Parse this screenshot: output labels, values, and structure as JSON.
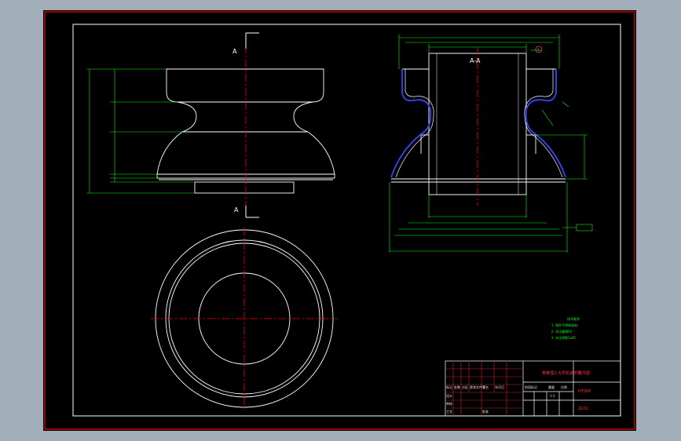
{
  "drawing": {
    "section_mark_top": "A",
    "section_mark_bottom": "A",
    "section_title": "A-A",
    "balloon_label": "1"
  },
  "notes": {
    "title": "技术要求",
    "lines": [
      "1. 铸件不得有缺陷",
      "2. 未注圆角R2",
      "3. 未注倒角1x45"
    ]
  },
  "title_block": {
    "school": "某某理工大学机械学院",
    "part_name": "零件图",
    "material": "HT200",
    "drawing_no": "ZJ-01",
    "scale": "1:1",
    "cells": [
      "标记",
      "处数",
      "分区",
      "更改文件号",
      "签名",
      "年月日",
      "设计",
      "审核",
      "工艺",
      "批准",
      "阶段标记",
      "重量",
      "比例"
    ]
  },
  "colors": {
    "background": "#a3aebb",
    "paper": "#000000",
    "frame": "#cc0000",
    "outline": "#ffffff",
    "dimension": "#00ff00",
    "centerline": "#ff0000",
    "highlight": "#3344ff"
  }
}
